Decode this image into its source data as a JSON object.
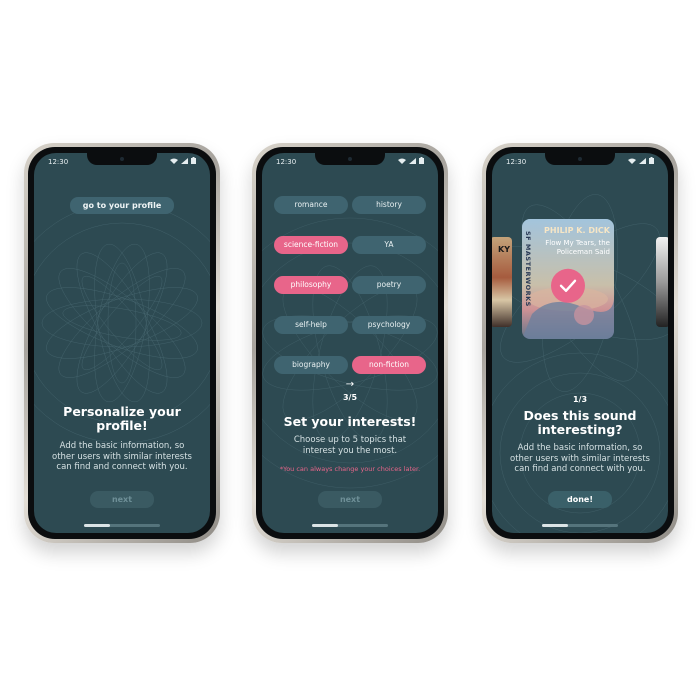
{
  "status": {
    "time": "12:30"
  },
  "colors": {
    "screen": "#2d4a52",
    "pill": "#3f6470",
    "accent": "#e8658a",
    "button": "#3a6069"
  },
  "screen1": {
    "top_button": "go to your profile",
    "title": "Personalize your profile!",
    "description": "Add the basic information, so other users with similar interests can find and connect with you.",
    "next": "next"
  },
  "screen2": {
    "topics": [
      {
        "label": "romance",
        "selected": false
      },
      {
        "label": "history",
        "selected": false
      },
      {
        "label": "science-fiction",
        "selected": true
      },
      {
        "label": "YA",
        "selected": false
      },
      {
        "label": "philosophy",
        "selected": true
      },
      {
        "label": "poetry",
        "selected": false
      },
      {
        "label": "self-help",
        "selected": false
      },
      {
        "label": "psychology",
        "selected": false
      },
      {
        "label": "biography",
        "selected": false
      },
      {
        "label": "non-fiction",
        "selected": true
      }
    ],
    "step_arrow": "→",
    "step": "3/5",
    "title": "Set your interests!",
    "description": "Choose up to 5 topics that interest you the most.",
    "note": "*You can always change your choices later.",
    "next": "next"
  },
  "screen3": {
    "book": {
      "author": "PHILIP K. DICK",
      "title": "Flow My Tears, the Policeman Said",
      "spine": "SF MASTERWORKS"
    },
    "left_book_fragment": "KY",
    "counter": "1/3",
    "title": "Does this sound interesting?",
    "description": "Add the basic information, so other users with similar interests can find and connect with you.",
    "done": "done!"
  }
}
